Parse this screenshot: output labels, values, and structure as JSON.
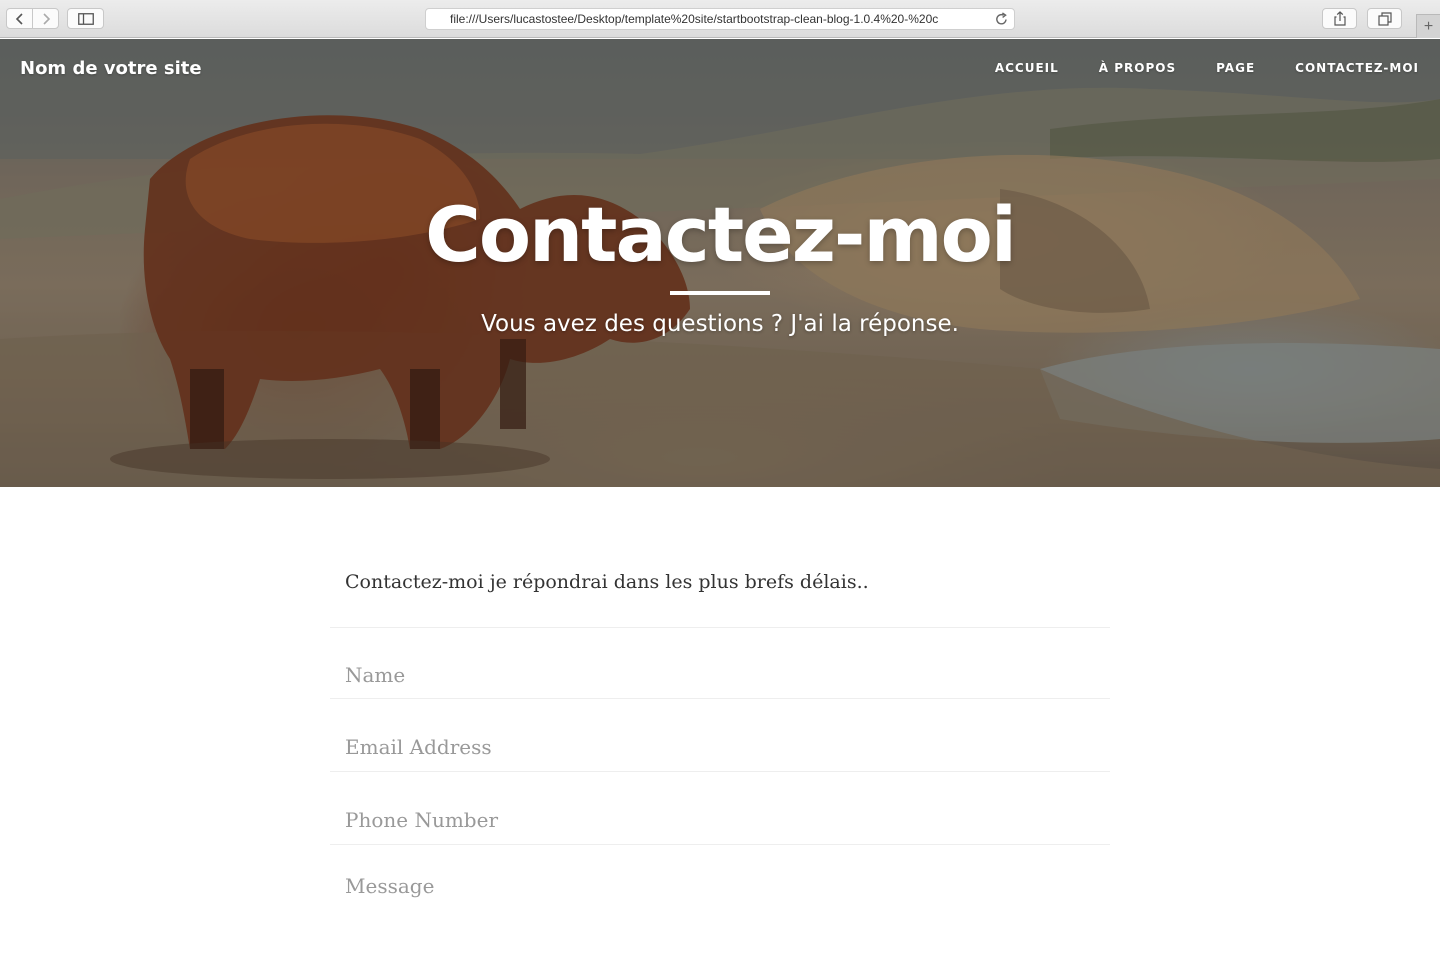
{
  "browser": {
    "url": "file:///Users/lucastostee/Desktop/template%20site/startbootstrap-clean-blog-1.0.4%20-%20c",
    "new_tab_label": "+"
  },
  "site": {
    "brand": "Nom de votre site",
    "nav": [
      {
        "label": "ACCUEIL"
      },
      {
        "label": "À PROPOS"
      },
      {
        "label": "PAGE"
      },
      {
        "label": "CONTACTEZ-MOI"
      }
    ]
  },
  "hero": {
    "title": "Contactez-moi",
    "subtitle": "Vous avez des questions ? J'ai la réponse."
  },
  "content": {
    "intro": "Contactez-moi je répondrai dans les plus brefs délais..",
    "form": {
      "name_placeholder": "Name",
      "email_placeholder": "Email Address",
      "phone_placeholder": "Phone Number",
      "message_placeholder": "Message"
    }
  },
  "colors": {
    "text": "#333333",
    "placeholder": "#999999",
    "divider": "#eeeeee",
    "hero_text": "#ffffff"
  }
}
